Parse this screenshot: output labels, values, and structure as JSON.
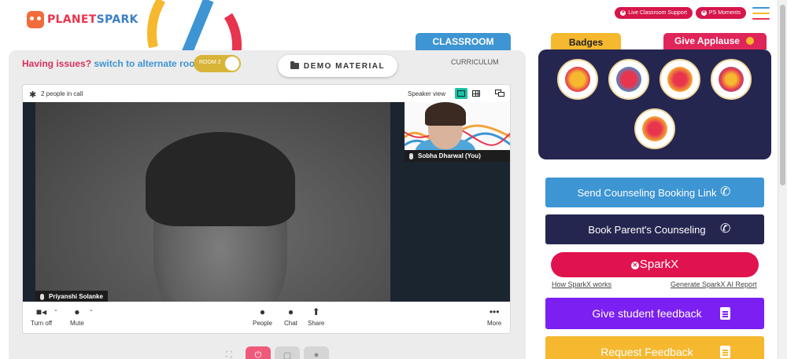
{
  "brand": {
    "logo_part1": "PLANET",
    "logo_part2": "SPARK"
  },
  "header": {
    "live_support": "Live Classroom Support",
    "ps_moments": "PS Moments"
  },
  "tabs": {
    "classroom": "CLASSROOM",
    "curriculum": "CURRICULUM",
    "badges": "Badges",
    "give_applause": "Give Applause"
  },
  "room": {
    "issues_text": "Having issues?",
    "switch_link": "switch to alternate room",
    "toggle_label": "ROOM 2",
    "demo_material": "DEMO MATERIAL"
  },
  "call": {
    "people_count": "2 people in call",
    "speaker_view": "Speaker view",
    "main_participant": "Priyanshi Solanke",
    "self_participant": "Sobha Dharwal (You)",
    "toolbar": {
      "camera": "Turn off",
      "mic": "Mute",
      "people": "People",
      "chat": "Chat",
      "share": "Share",
      "more": "More"
    }
  },
  "actions": {
    "counseling_link": "Send Counseling Booking Link",
    "parent_counseling": "Book Parent's Counseling",
    "sparkx": "SparkX",
    "how_sparkx": "How SparkX works",
    "generate_report": "Generate SparkX AI Report",
    "student_feedback": "Give student feedback",
    "request_feedback": "Request Feedback"
  },
  "colors": {
    "brand_red": "#e0134f",
    "brand_blue": "#3d95d3",
    "navy": "#252650",
    "purple": "#7b1ff2",
    "yellow": "#f5b82e",
    "toggle_active": "#18c2a5"
  },
  "icons": [
    "gear-icon",
    "mic-icon",
    "camera-icon",
    "people-icon",
    "chat-icon",
    "share-screen-icon",
    "more-icon",
    "phone-icon",
    "document-icon",
    "folder-icon"
  ]
}
